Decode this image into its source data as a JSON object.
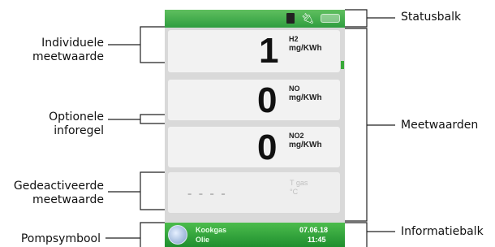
{
  "left_labels": {
    "individual_value": [
      "Individuele",
      "meetwaarde"
    ],
    "optional_line": [
      "Optionele",
      "inforegel"
    ],
    "deactivated_value": [
      "Gedeactiveerde",
      "meetwaarde"
    ],
    "pump_symbol": "Pompsymbool"
  },
  "right_labels": {
    "status_bar": "Statusbalk",
    "measured_values": "Meetwaarden",
    "info_bar": "Informatiebalk"
  },
  "device": {
    "measurements": [
      {
        "value": "1",
        "gas": "H2",
        "unit": "mg/KWh"
      },
      {
        "value": "0",
        "gas": "NO",
        "unit": "mg/KWh"
      },
      {
        "value": "0",
        "gas": "NO2",
        "unit": "mg/KWh"
      }
    ],
    "deactivated": {
      "dashes": "- - - -",
      "gas": "T gas",
      "unit": "°C"
    },
    "info": {
      "fuel": "Kookgas",
      "sub": "Olie",
      "date": "07.06.18",
      "time": "11:45"
    }
  }
}
